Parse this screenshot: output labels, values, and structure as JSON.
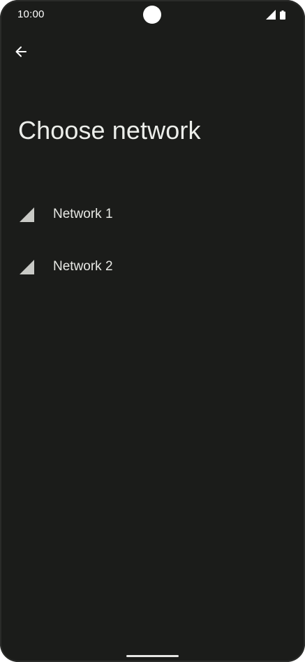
{
  "status_bar": {
    "time": "10:00",
    "icons": [
      "cell-signal-icon",
      "battery-icon"
    ]
  },
  "toolbar": {
    "back_icon": "arrow-left-icon"
  },
  "page": {
    "title": "Choose network"
  },
  "networks": [
    {
      "label": "Network 1",
      "icon": "signal-strength-icon"
    },
    {
      "label": "Network 2",
      "icon": "signal-strength-icon"
    }
  ],
  "colors": {
    "background": "#1b1c1a",
    "text": "#e8e9e5",
    "signal_icon": "#c9cac6"
  }
}
